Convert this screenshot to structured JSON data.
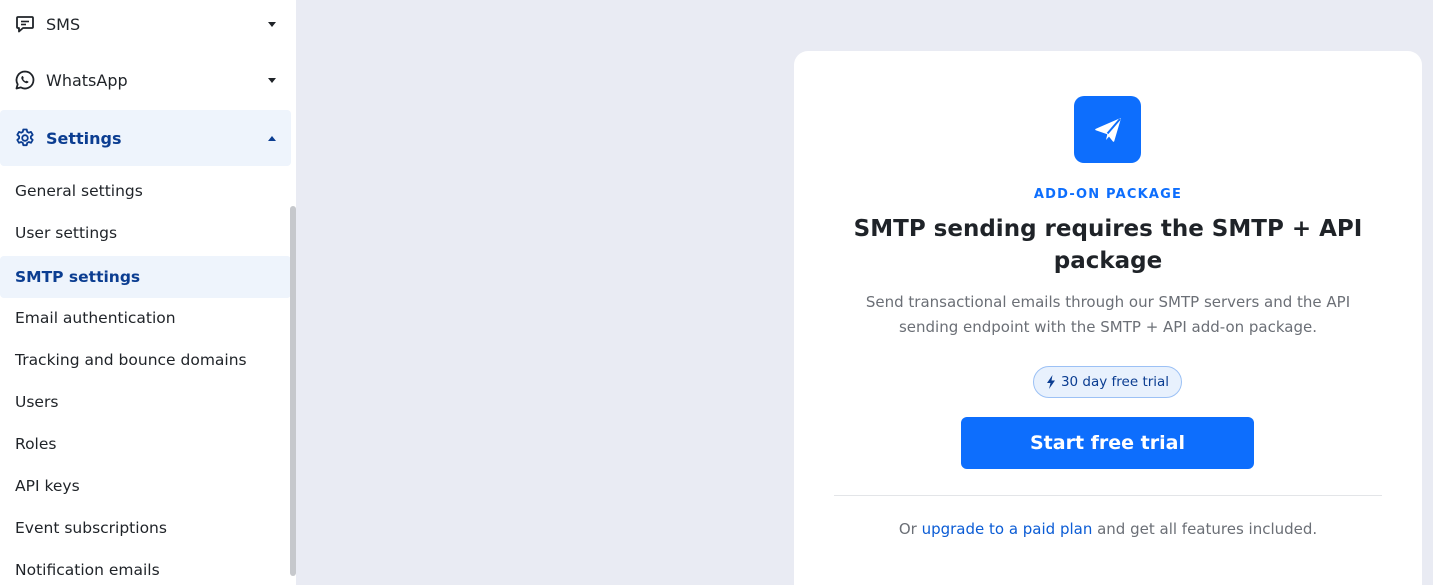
{
  "sidebar": {
    "top_items": [
      {
        "label": "SMS",
        "icon": "chat-icon"
      },
      {
        "label": "WhatsApp",
        "icon": "whatsapp-icon"
      },
      {
        "label": "Settings",
        "icon": "gear-icon",
        "active": true
      }
    ],
    "settings_items": [
      {
        "label": "General settings"
      },
      {
        "label": "User settings"
      },
      {
        "label": "SMTP settings",
        "active": true
      },
      {
        "label": "Email authentication"
      },
      {
        "label": "Tracking and bounce domains"
      },
      {
        "label": "Users"
      },
      {
        "label": "Roles"
      },
      {
        "label": "API keys"
      },
      {
        "label": "Event subscriptions"
      },
      {
        "label": "Notification emails"
      }
    ]
  },
  "card": {
    "icon": "paper-plane-icon",
    "eyebrow": "ADD-ON PACKAGE",
    "title": "SMTP sending requires the SMTP + API package",
    "description": "Send transactional emails through our SMTP servers and the API sending endpoint with the SMTP + API add-on package.",
    "trial_badge": "30 day free trial",
    "cta_label": "Start free trial",
    "footer_prefix": "Or ",
    "footer_link": "upgrade to a paid plan",
    "footer_suffix": " and get all features included."
  },
  "colors": {
    "accent": "#0d6efd",
    "active_nav_bg": "#eef4fc",
    "active_nav_text": "#0b3d91",
    "page_bg": "#e9ebf3"
  }
}
